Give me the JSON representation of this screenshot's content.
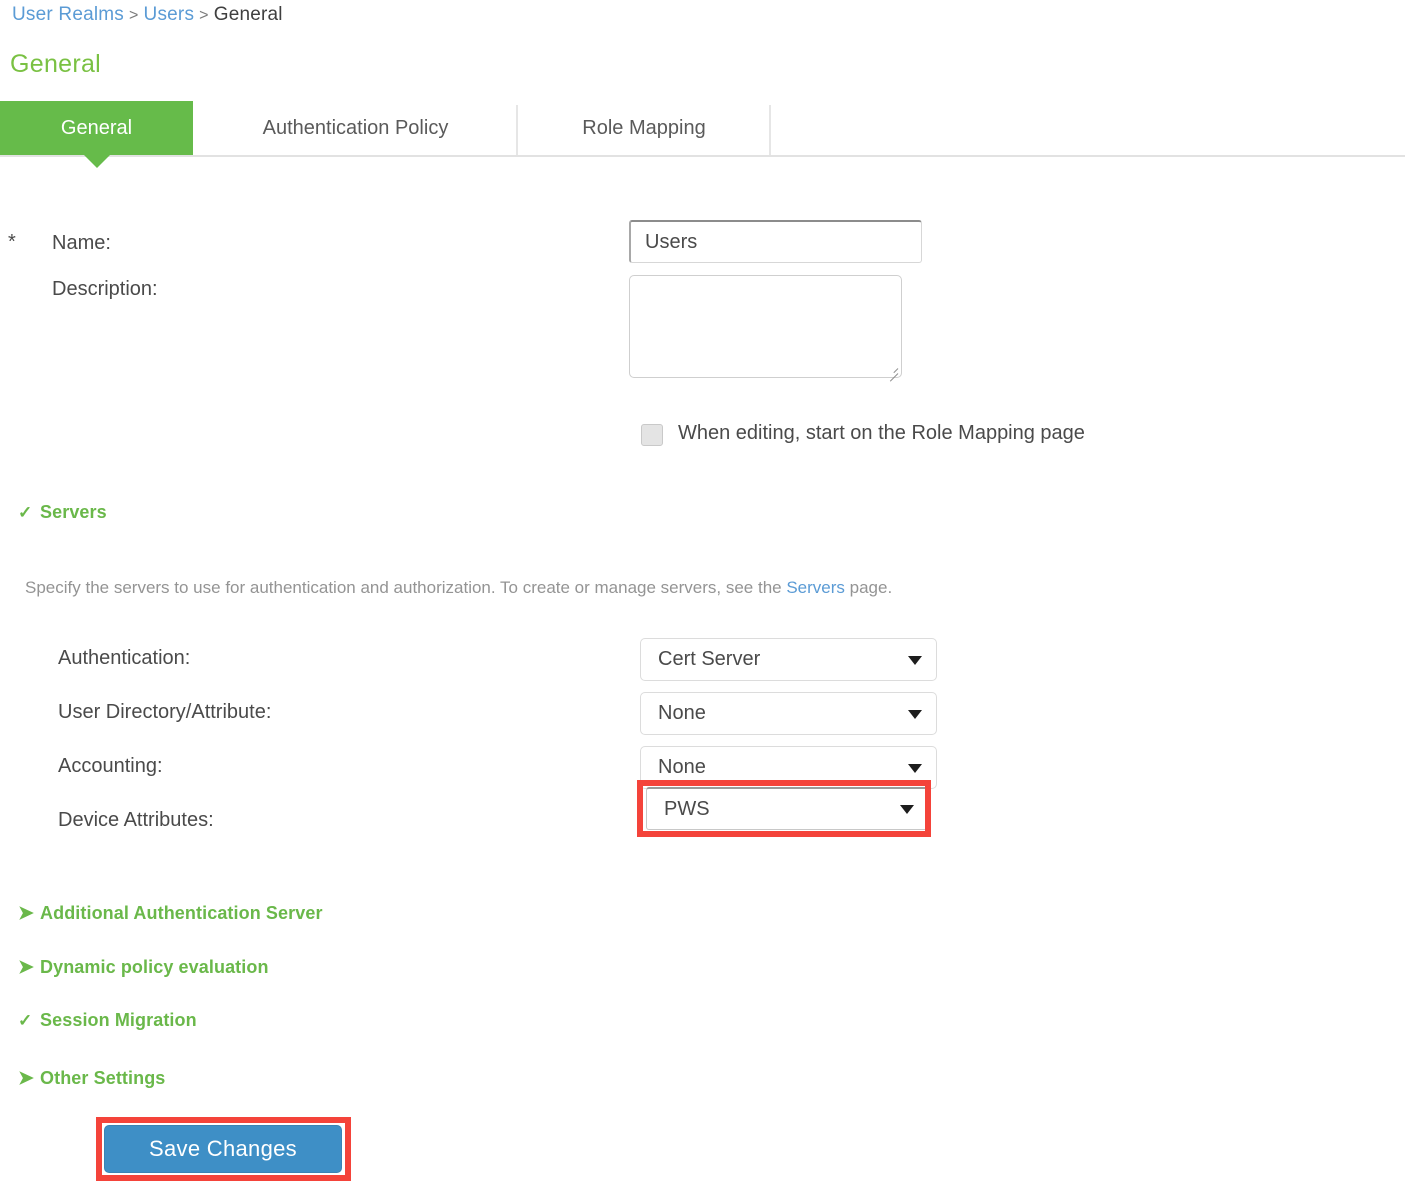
{
  "breadcrumb": {
    "items": [
      {
        "label": "User Realms",
        "type": "link"
      },
      {
        "label": "Users",
        "type": "link"
      },
      {
        "label": "General",
        "type": "current"
      }
    ],
    "separator": ">"
  },
  "page": {
    "title": "General",
    "title_color": "#7ac143"
  },
  "tabs": [
    {
      "label": "General",
      "active": true
    },
    {
      "label": "Authentication Policy",
      "active": false
    },
    {
      "label": "Role Mapping",
      "active": false
    }
  ],
  "form": {
    "required_marker": "*",
    "name_label": "Name:",
    "name_value": "Users",
    "name_placeholder": "",
    "description_label": "Description:",
    "description_value": "",
    "description_placeholder": "",
    "role_mapping_checkbox_label": "When editing, start on the Role Mapping page",
    "role_mapping_checkbox_checked": false
  },
  "servers_section": {
    "title": "Servers",
    "icon": "chevron-down-icon",
    "expanded": true,
    "help_text_before": "Specify the servers to use for authentication and authorization. To create or manage servers, see the ",
    "help_link": "Servers",
    "help_text_after": " page.",
    "rows": [
      {
        "label": "Authentication:",
        "value": "Cert Server",
        "highlighted": false
      },
      {
        "label": "User Directory/Attribute:",
        "value": "None",
        "highlighted": false
      },
      {
        "label": "Accounting:",
        "value": "None",
        "highlighted": false
      },
      {
        "label": "Device Attributes:",
        "value": "PWS",
        "highlighted": true
      }
    ]
  },
  "collapsible_sections": [
    {
      "title": "Additional Authentication Server",
      "icon": "chevron-right-icon",
      "expanded": false
    },
    {
      "title": "Dynamic policy evaluation",
      "icon": "chevron-right-icon",
      "expanded": false
    },
    {
      "title": "Session Migration",
      "icon": "chevron-down-icon",
      "expanded": true
    },
    {
      "title": "Other Settings",
      "icon": "chevron-right-icon",
      "expanded": false
    }
  ],
  "actions": {
    "save_label": "Save Changes",
    "save_color": "#3e8fc6"
  },
  "annotations": {
    "color": "#f4433a",
    "targets": [
      "device-attributes-select",
      "save-changes-button"
    ]
  },
  "icons": {
    "chevron_right": "❯",
    "chevron_down": "⌄",
    "select_caret": "▼"
  }
}
